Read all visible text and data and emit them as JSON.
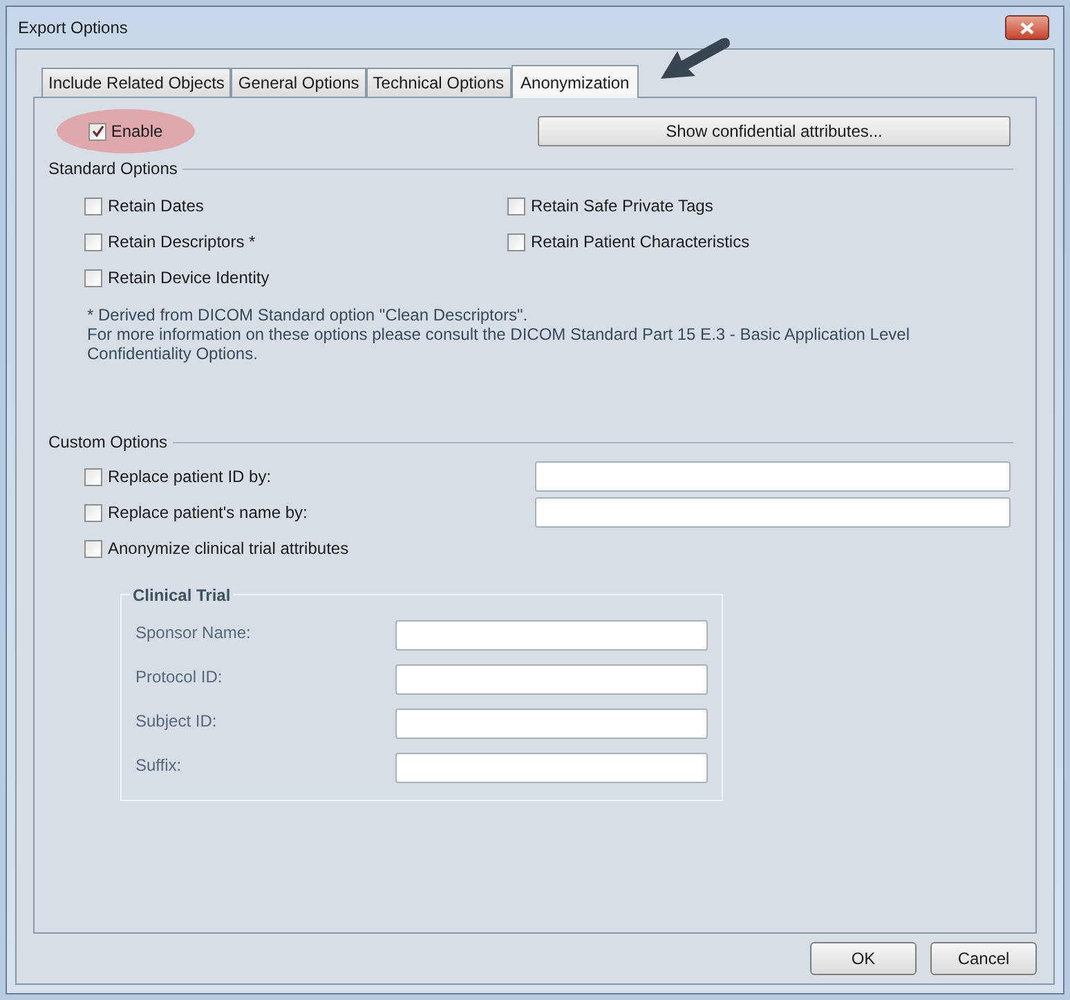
{
  "window": {
    "title": "Export Options"
  },
  "tabs": [
    {
      "label": "Include Related Objects",
      "selected": false
    },
    {
      "label": "General Options",
      "selected": false
    },
    {
      "label": "Technical Options",
      "selected": false
    },
    {
      "label": "Anonymization",
      "selected": true
    }
  ],
  "enable": {
    "label": "Enable",
    "checked": true
  },
  "show_button": "Show confidential attributes...",
  "standard_options": {
    "title": "Standard Options",
    "options": [
      {
        "label": "Retain Dates",
        "checked": false
      },
      {
        "label": "Retain Safe Private Tags",
        "checked": false
      },
      {
        "label": "Retain Descriptors *",
        "checked": false
      },
      {
        "label": "Retain Patient Characteristics",
        "checked": false
      },
      {
        "label": "Retain Device Identity",
        "checked": false
      }
    ],
    "footnote": "* Derived from DICOM Standard option \"Clean Descriptors\".",
    "info": "For more information on these options please consult the DICOM Standard Part 15 E.3 - Basic Application Level Confidentiality Options."
  },
  "custom_options": {
    "title": "Custom Options",
    "options": [
      {
        "kind": "field",
        "label": "Replace patient ID by:",
        "checked": false
      },
      {
        "kind": "field",
        "label": "Replace patient's name by:",
        "checked": false
      },
      {
        "kind": "plain",
        "label": "Anonymize clinical trial attributes",
        "checked": false
      }
    ]
  },
  "clinical_trial": {
    "title": "Clinical Trial",
    "disabled": true,
    "fields": [
      {
        "label": "Sponsor Name:"
      },
      {
        "label": "Protocol ID:"
      },
      {
        "label": "Subject ID:"
      },
      {
        "label": "Suffix:"
      }
    ]
  },
  "buttons": [
    "OK",
    "Cancel"
  ]
}
